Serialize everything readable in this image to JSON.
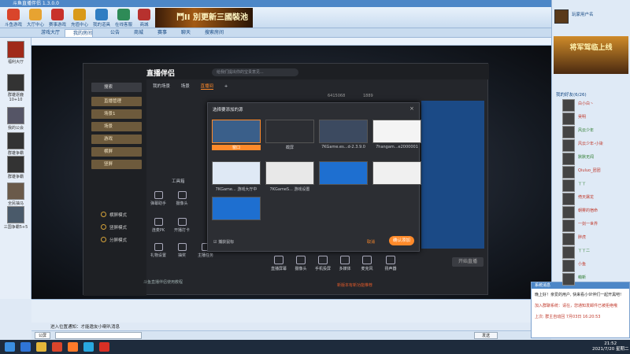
{
  "client": {
    "window_title": "斗鱼直播伴侣 1.3.0.0",
    "toolbar": [
      {
        "label": "斗鱼游戏",
        "icon": "game-icon",
        "color": "#d9452b"
      },
      {
        "label": "大厅中心",
        "icon": "hall-icon",
        "color": "#e7a331"
      },
      {
        "label": "赛事游戏",
        "icon": "trophy-icon",
        "color": "#c8322b"
      },
      {
        "label": "充值中心",
        "icon": "coin-icon",
        "color": "#d99a1a"
      },
      {
        "label": "我的道具",
        "icon": "bag-icon",
        "color": "#2f7dc2"
      },
      {
        "label": "在线客服",
        "icon": "service-icon",
        "color": "#2e8b57"
      },
      {
        "label": "商城",
        "icon": "shop-icon",
        "color": "#b7312e"
      }
    ],
    "banner_text": "鬥II 別更新三國裝池",
    "tabs": [
      "游戏大厅",
      "我的房间",
      "公告",
      "商城",
      "赛事",
      "聊天",
      "搜索房间"
    ],
    "active_tab": 1
  },
  "left_sidebar": [
    {
      "label": "福利大厅",
      "icon": "gift-icon"
    },
    {
      "label": "群雄逐鹿10+10",
      "icon": "battle-icon"
    },
    {
      "label": "我的公会",
      "icon": "guild-icon"
    },
    {
      "label": "群雄争霸",
      "icon": "war-icon"
    },
    {
      "label": "群雄争霸",
      "icon": "war-icon"
    },
    {
      "label": "全民抽马",
      "icon": "horse-icon"
    },
    {
      "label": "三国争霸5+5",
      "icon": "kingdom-icon"
    }
  ],
  "app": {
    "logo": "直播伴侣",
    "search_placeholder": "给我们提出你的宝贵意见...",
    "tabs": [
      "我的场景",
      "场景",
      "直播间",
      "+"
    ],
    "active_tab": 2,
    "sidebar_buttons": [
      "直播管理",
      "场景1",
      "场景",
      "游戏",
      "横屏",
      "竖屏"
    ],
    "radios": [
      "横屏模式",
      "竖屏模式",
      "分屏模式"
    ],
    "tool_section": "工具箱",
    "tools": [
      "弹幕助手",
      "摄像头",
      "连麦PK",
      "开播打卡",
      "礼物设置",
      "抽奖",
      "主播任务",
      "音乐"
    ],
    "tool_footer": "斗鱼直播伴侣使用教程",
    "bottom_buttons": [
      "直播屏幕",
      "摄像头",
      "手机投屏",
      "多媒体",
      "麦克风",
      "扬声器"
    ],
    "go_live": "开始直播",
    "stats": {
      "fans": "6415068",
      "heat": "1889"
    },
    "status_hint": "新版本有新功能推荐"
  },
  "dialog": {
    "title": "选择要添加的源",
    "sources": [
      {
        "label": "窗口",
        "thumb_color": "#3a5f8a",
        "selected": true
      },
      {
        "label": "截屏",
        "thumb_color": "#2c2e33",
        "selected": false
      },
      {
        "label": "7KGame.es...d-2.3.9.0",
        "thumb_color": "#3c4a60",
        "selected": false
      },
      {
        "label": "7hangam...e2000001",
        "thumb_color": "#f4f4f4",
        "selected": false
      },
      {
        "label": "7KGame... 游戏大厅中",
        "thumb_color": "#dfe9f5",
        "selected": false
      },
      {
        "label": "7KGameS... 游戏设置",
        "thumb_color": "#e8e8e8",
        "selected": false
      },
      {
        "label": "",
        "thumb_color": "#1e6fd0",
        "selected": false
      },
      {
        "label": "",
        "thumb_color": "#f0f0f0",
        "selected": false
      },
      {
        "label": "",
        "thumb_color": "#1e6fd0",
        "selected": false
      }
    ],
    "checkbox_label": "捕获鼠标",
    "cancel_label": "取消",
    "ok_label": "确认添加"
  },
  "chat": {
    "message": "进入位置通知：才能邀友小喇叭消息",
    "channel": "公屏",
    "send_label": "发送"
  },
  "right_panel": {
    "username": "玩家用户名",
    "ad_text": "将军驾临上线",
    "section": "我的好友(6/26)",
    "users": [
      {
        "name": "白小白丶",
        "highlight": true
      },
      {
        "name": "吴明",
        "highlight": true
      },
      {
        "name": "风云少年",
        "highlight": false
      },
      {
        "name": "风云少年-小柒",
        "highlight": true
      },
      {
        "name": "默默无闻",
        "highlight": false
      },
      {
        "name": "Qiuluo_团团",
        "highlight": true
      },
      {
        "name": "丫丫",
        "highlight": false
      },
      {
        "name": "倚天屠龙",
        "highlight": true
      },
      {
        "name": "朝雾的宿命",
        "highlight": true
      },
      {
        "name": "一剑一世界",
        "highlight": true
      },
      {
        "name": "胖虎",
        "highlight": true
      },
      {
        "name": "丫丫二",
        "highlight": false
      },
      {
        "name": "小鱼",
        "highlight": true
      },
      {
        "name": "萌新",
        "highlight": false
      }
    ]
  },
  "popup": {
    "title": "系统消息",
    "lines": [
      {
        "text": "晚上好！亲爱的用户, 快来看小伙伴们一起开黑吧!",
        "color": "#222"
      },
      {
        "text": "加入群聊系统：请在，您通知发邮件已被拒绝哦",
        "color": "#c0392b"
      },
      {
        "text": "上次: 群主自动回 7月03日 16:20:53",
        "color": "#c0392b"
      }
    ]
  },
  "taskbar": {
    "time": "21:52",
    "date": "2021/7/20 星期二",
    "apps": [
      {
        "icon": "start-icon",
        "color": "#3b8ee0"
      },
      {
        "icon": "browser-icon",
        "color": "#2f74d6"
      },
      {
        "icon": "folder-icon",
        "color": "#e4b73a"
      },
      {
        "icon": "game-client-icon",
        "color": "#d9452b"
      },
      {
        "icon": "stream-app-icon",
        "color": "#ff7a2a"
      },
      {
        "icon": "chat-icon",
        "color": "#29a8e0"
      },
      {
        "icon": "media-icon",
        "color": "#d93025"
      }
    ]
  }
}
